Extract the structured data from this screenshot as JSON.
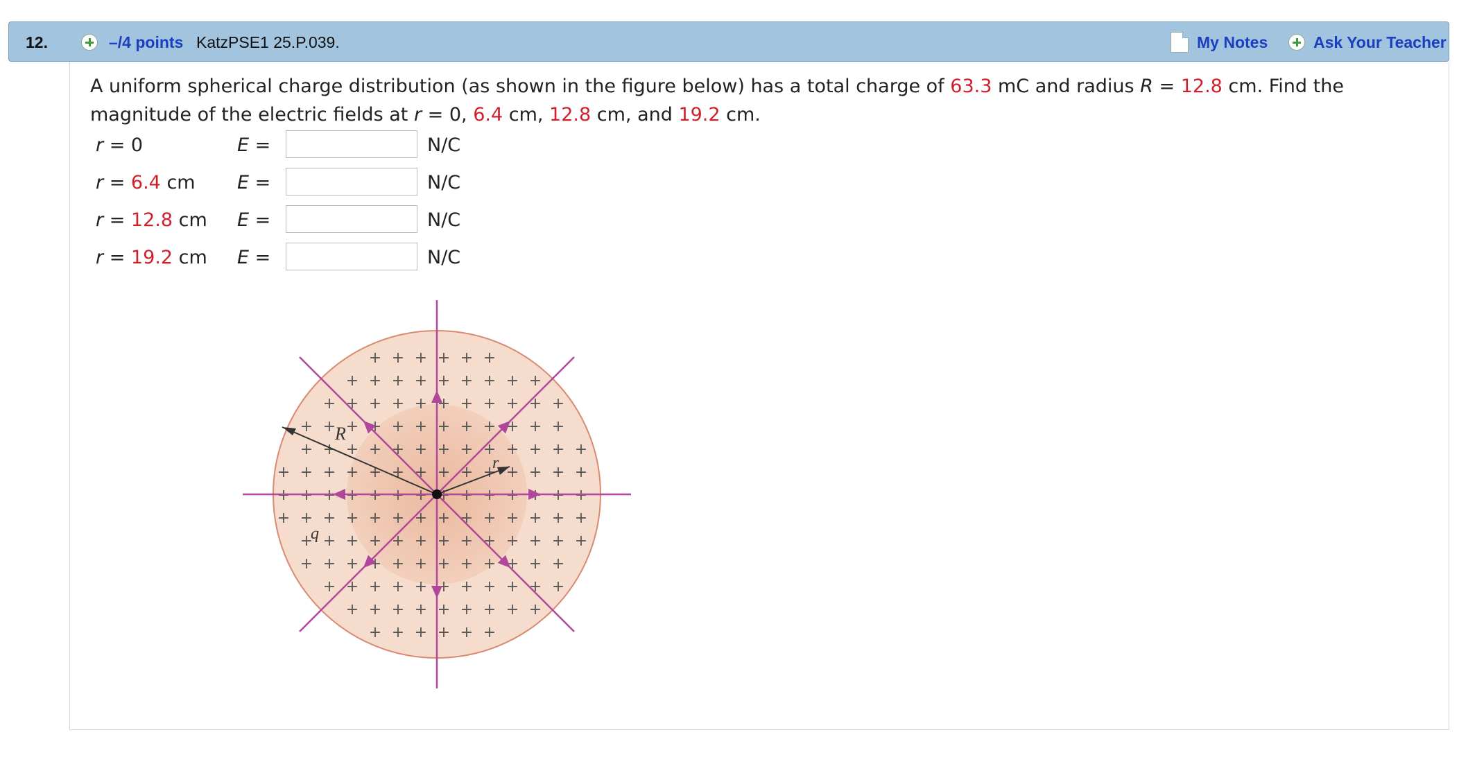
{
  "question": {
    "number": "12.",
    "points": "–/4 points",
    "id": "KatzPSE1 25.P.039.",
    "my_notes": "My Notes",
    "ask_teacher": "Ask Your Teacher"
  },
  "prompt": {
    "p1": "A uniform spherical charge distribution (as shown in the figure below) has a total charge of ",
    "charge": "63.3",
    "p2": " mC and radius ",
    "R_var": "R",
    "p3": " = ",
    "radius": "12.8",
    "p4": " cm. Find the magnitude of the electric fields at ",
    "r_var": "r",
    "p5": " = 0, ",
    "r1": "6.4",
    "p6": " cm, ",
    "r2": "12.8",
    "p7": " cm, and ",
    "r3": "19.2",
    "p8": " cm."
  },
  "rows": [
    {
      "r_prefix": "r",
      "r_eq": " = 0",
      "r_value": "",
      "r_unit": "",
      "e_label": "E",
      "e_eq": " =",
      "answer": "",
      "unit": "N/C"
    },
    {
      "r_prefix": "r",
      "r_eq": " = ",
      "r_value": "6.4",
      "r_unit": " cm",
      "e_label": "E",
      "e_eq": " =",
      "answer": "",
      "unit": "N/C"
    },
    {
      "r_prefix": "r",
      "r_eq": " = ",
      "r_value": "12.8",
      "r_unit": " cm",
      "e_label": "E",
      "e_eq": " =",
      "answer": "",
      "unit": "N/C"
    },
    {
      "r_prefix": "r",
      "r_eq": " = ",
      "r_value": "19.2",
      "r_unit": " cm",
      "e_label": "E",
      "e_eq": " =",
      "answer": "",
      "unit": "N/C"
    }
  ],
  "figure": {
    "label_R": "R",
    "label_r": "r",
    "label_q": "q",
    "plus_glyph": "+",
    "colors": {
      "sphere_fill": "#f6dccd",
      "sphere_edge": "#d88a72",
      "inner_fill": "#eebfa6",
      "field_line": "#b0479a"
    }
  }
}
